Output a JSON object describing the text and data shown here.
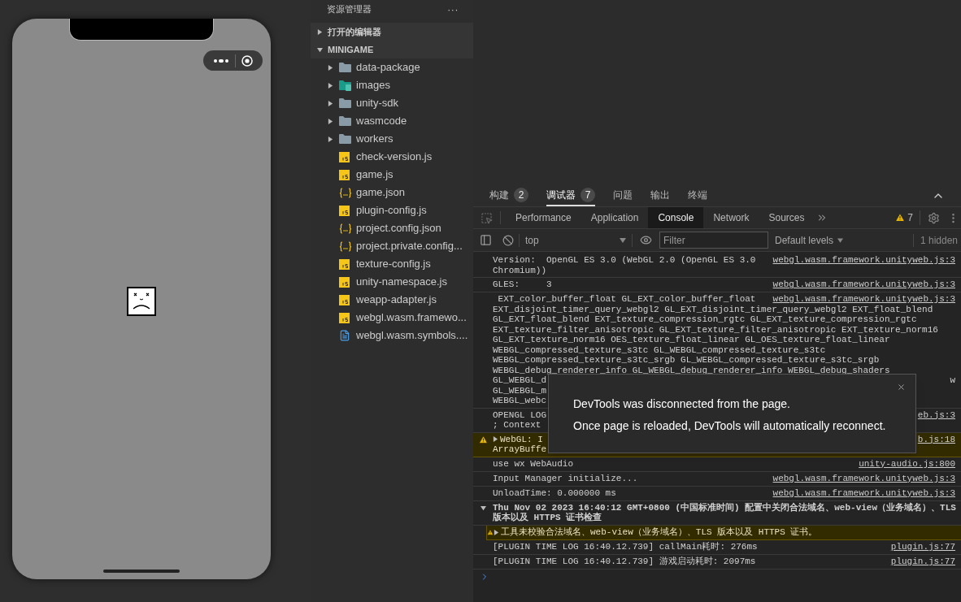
{
  "explorer": {
    "title": "资源管理器",
    "more": "···",
    "sections": [
      {
        "label": "打开的编辑器",
        "expanded": false
      },
      {
        "label": "MINIGAME",
        "expanded": true,
        "children": [
          {
            "label": "data-package",
            "kind": "folder",
            "expanded": false
          },
          {
            "label": "images",
            "kind": "image-folder",
            "expanded": false
          },
          {
            "label": "unity-sdk",
            "kind": "folder",
            "expanded": false
          },
          {
            "label": "wasmcode",
            "kind": "folder",
            "expanded": false
          },
          {
            "label": "workers",
            "kind": "folder",
            "expanded": false
          },
          {
            "label": "check-version.js",
            "kind": "js"
          },
          {
            "label": "game.js",
            "kind": "js"
          },
          {
            "label": "game.json",
            "kind": "json"
          },
          {
            "label": "plugin-config.js",
            "kind": "js"
          },
          {
            "label": "project.config.json",
            "kind": "json"
          },
          {
            "label": "project.private.config...",
            "kind": "json"
          },
          {
            "label": "texture-config.js",
            "kind": "js"
          },
          {
            "label": "unity-namespace.js",
            "kind": "js"
          },
          {
            "label": "weapp-adapter.js",
            "kind": "js"
          },
          {
            "label": "webgl.wasm.framewo...",
            "kind": "js"
          },
          {
            "label": "webgl.wasm.symbols....",
            "kind": "file"
          }
        ]
      }
    ]
  },
  "panel_tabs": [
    {
      "label": "构建",
      "count": "2",
      "selected": false
    },
    {
      "label": "调试器",
      "count": "7",
      "selected": true
    },
    {
      "label": "问题",
      "selected": false
    },
    {
      "label": "输出",
      "selected": false
    },
    {
      "label": "终端",
      "selected": false
    }
  ],
  "devtools_tabs": [
    {
      "label": "Performance",
      "selected": false
    },
    {
      "label": "Application",
      "selected": false
    },
    {
      "label": "Console",
      "selected": true
    },
    {
      "label": "Network",
      "selected": false
    },
    {
      "label": "Sources",
      "selected": false
    }
  ],
  "warning_count": "7",
  "console_toolbar": {
    "context": "top",
    "filter_placeholder": "Filter",
    "levels": "Default levels",
    "hidden": "1 hidden"
  },
  "messages": [
    {
      "kind": "log",
      "lines": [
        "Version:  OpenGL ES 3.0 (WebGL 2.0 (OpenGL ES 3.0",
        "Chromium))"
      ],
      "source": "webgl.wasm.framework.unityweb.js:3"
    },
    {
      "kind": "log",
      "lines": [
        "GLES:     3"
      ],
      "source": "webgl.wasm.framework.unityweb.js:3"
    },
    {
      "kind": "log",
      "lines": [
        " EXT_color_buffer_float GL_EXT_color_buffer_float",
        "EXT_disjoint_timer_query_webgl2 GL_EXT_disjoint_timer_query_webgl2 EXT_float_blend",
        "GL_EXT_float_blend EXT_texture_compression_rgtc GL_EXT_texture_compression_rgtc",
        "EXT_texture_filter_anisotropic GL_EXT_texture_filter_anisotropic EXT_texture_norm16",
        "GL_EXT_texture_norm16 OES_texture_float_linear GL_OES_texture_float_linear",
        "WEBGL_compressed_texture_s3tc GL_WEBGL_compressed_texture_s3tc",
        "WEBGL_compressed_texture_s3tc_srgb GL_WEBGL_compressed_texture_s3tc_srgb",
        "WEBGL_debug_renderer_info GL_WEBGL_debug_renderer_info WEBGL_debug_shaders",
        {
          "text": "GL_WEBGL_d",
          "tail": "w"
        },
        "GL_WEBGL_m",
        "WEBGL_webc"
      ],
      "source": "webgl.wasm.framework.unityweb.js:3"
    },
    {
      "kind": "log",
      "lines": [
        "OPENGL LOG",
        "; Context"
      ],
      "source": "eb.js:3"
    },
    {
      "kind": "warning",
      "expanded": false,
      "lines": [
        "WebGL: I",
        "ArrayBuffe"
      ],
      "source": "b.js:18"
    },
    {
      "kind": "log",
      "lines": [
        "use wx WebAudio"
      ],
      "source": "unity-audio.js:800"
    },
    {
      "kind": "log",
      "lines": [
        "Input Manager initialize..."
      ],
      "source": "webgl.wasm.framework.unityweb.js:3"
    },
    {
      "kind": "log",
      "lines": [
        "UnloadTime: 0.000000 ms"
      ],
      "source": "webgl.wasm.framework.unityweb.js:3"
    },
    {
      "kind": "group",
      "expanded": true,
      "lines": [
        "Thu Nov 02 2023 16:40:12 GMT+0800 (中国标准时间) 配置中关闭合法域名、web-view（业务域名）、TLS",
        "版本以及 HTTPS 证书检查"
      ],
      "children": [
        {
          "kind": "warning",
          "expanded": false,
          "lines": [
            "工具未校验合法域名、web-view（业务域名）、TLS 版本以及 HTTPS 证书。"
          ]
        }
      ]
    },
    {
      "kind": "log",
      "lines": [
        "[PLUGIN TIME LOG 16:40.12.739] callMain耗时: 276ms"
      ],
      "source": "plugin.js:77"
    },
    {
      "kind": "log",
      "lines": [
        "[PLUGIN TIME LOG 16:40.12.739] 游戏启动耗时: 2097ms"
      ],
      "source": "plugin.js:77"
    }
  ],
  "dialog": {
    "lines": [
      "DevTools was disconnected from the page.",
      "Once page is reloaded, DevTools will automatically reconnect."
    ]
  }
}
